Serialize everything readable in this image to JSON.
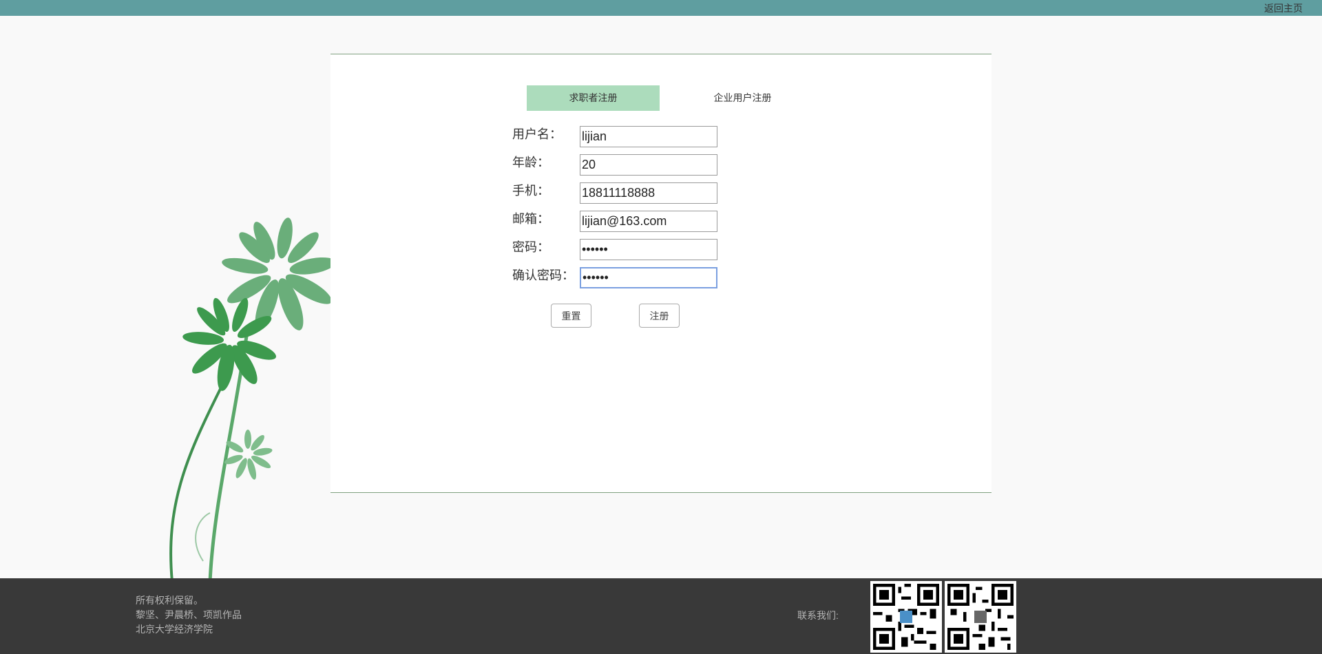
{
  "header": {
    "home_link": "返回主页"
  },
  "tabs": [
    {
      "label": "求职者注册",
      "active": true
    },
    {
      "label": "企业用户注册",
      "active": false
    }
  ],
  "form": {
    "username": {
      "label": "用户名：",
      "value": "lijian"
    },
    "age": {
      "label": "年龄：",
      "value": "20"
    },
    "phone": {
      "label": "手机：",
      "value": "18811118888"
    },
    "email": {
      "label": "邮箱：",
      "value": "lijian@163.com"
    },
    "password": {
      "label": "密码：",
      "value": "123456"
    },
    "confirm": {
      "label": "确认密码：",
      "value": "123456"
    }
  },
  "buttons": {
    "reset": "重置",
    "register": "注册"
  },
  "footer": {
    "line1": "所有权利保留。",
    "line2": "黎坚、尹晨桥、项凯作品",
    "line3": "北京大学经济学院",
    "contact": "联系我们:"
  },
  "colors": {
    "topbar": "#5f9ea0",
    "tab_active": "#acdcbc",
    "footer": "#393939",
    "leaf": "#4e9a5e"
  },
  "icons": [
    "flower-illustration",
    "qr-code-icon"
  ]
}
